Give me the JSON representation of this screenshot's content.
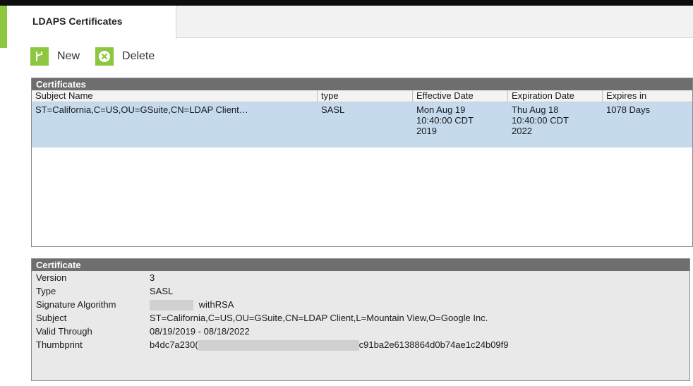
{
  "tab": {
    "label": "LDAPS Certificates"
  },
  "toolbar": {
    "new_label": "New",
    "delete_label": "Delete"
  },
  "certificates": {
    "title": "Certificates",
    "columns": [
      "Subject Name",
      "type",
      "Effective Date",
      "Expiration Date",
      "Expires in"
    ],
    "rows": [
      {
        "subject": "ST=California,C=US,OU=GSuite,CN=LDAP Client…",
        "type": "SASL",
        "effective": [
          "Mon Aug 19",
          "10:40:00 CDT",
          "2019"
        ],
        "expiration": [
          "Thu Aug 18",
          "10:40:00 CDT",
          "2022"
        ],
        "expires_in": "1078 Days"
      }
    ]
  },
  "certificate": {
    "title": "Certificate",
    "fields": [
      {
        "label": "Version",
        "value": "3"
      },
      {
        "label": "Type",
        "value": "SASL"
      },
      {
        "label": "Signature Algorithm",
        "value": "withRSA"
      },
      {
        "label": "Subject",
        "value": "ST=California,C=US,OU=GSuite,CN=LDAP Client,L=Mountain View,O=Google Inc."
      },
      {
        "label": "Valid Through",
        "value": "08/19/2019 - 08/18/2022"
      },
      {
        "label": "Thumbprint",
        "value_start": "b4dc7a230(",
        "value_end": "c91ba2e6138864d0b74ae1c24b09f9"
      }
    ]
  },
  "colors": {
    "accent": "#8dc63f",
    "panel_header": "#6e6e6e",
    "selected_row": "#c6daee"
  }
}
